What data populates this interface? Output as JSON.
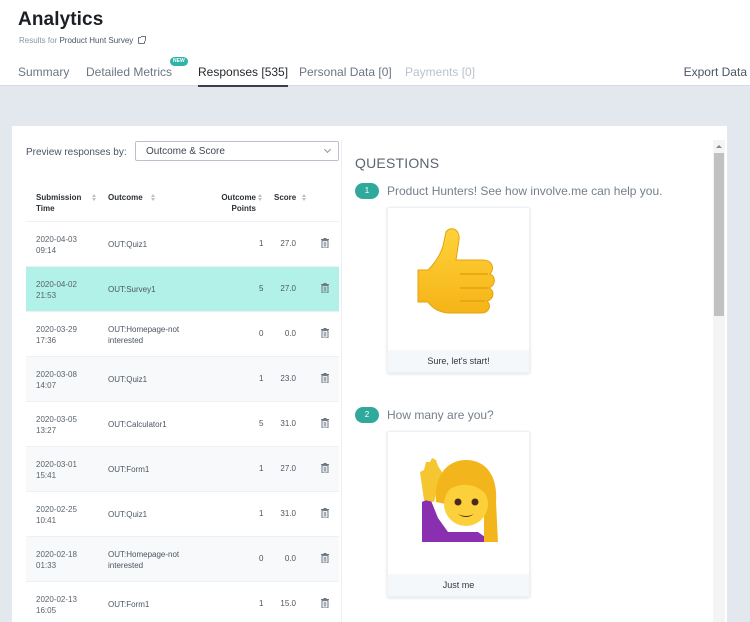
{
  "header": {
    "title": "Analytics",
    "subtitle_prefix": "Results for",
    "survey_name": "Product Hunt Survey",
    "export_label": "Export Data"
  },
  "tabs": [
    {
      "label": "Summary",
      "state": "normal"
    },
    {
      "label": "Detailed Metrics",
      "state": "normal",
      "badge": "NEW"
    },
    {
      "label": "Responses [535]",
      "state": "active"
    },
    {
      "label": "Personal Data [0]",
      "state": "normal"
    },
    {
      "label": "Payments [0]",
      "state": "disabled"
    }
  ],
  "preview": {
    "label": "Preview responses by:",
    "selected": "Outcome & Score"
  },
  "table": {
    "columns": [
      "Submission Time",
      "Outcome",
      "Outcome Points",
      "Score"
    ],
    "rows": [
      {
        "date": "2020-04-03",
        "time": "09:14",
        "outcome": "OUT:Quiz1",
        "points": "1",
        "score": "27.0",
        "selected": false
      },
      {
        "date": "2020-04-02",
        "time": "21:53",
        "outcome": "OUT:Survey1",
        "points": "5",
        "score": "27.0",
        "selected": true
      },
      {
        "date": "2020-03-29",
        "time": "17:36",
        "outcome": "OUT:Homepage-not interested",
        "points": "0",
        "score": "0.0",
        "selected": false
      },
      {
        "date": "2020-03-08",
        "time": "14:07",
        "outcome": "OUT:Quiz1",
        "points": "1",
        "score": "23.0",
        "selected": false
      },
      {
        "date": "2020-03-05",
        "time": "13:27",
        "outcome": "OUT:Calculator1",
        "points": "5",
        "score": "31.0",
        "selected": false
      },
      {
        "date": "2020-03-01",
        "time": "15:41",
        "outcome": "OUT:Form1",
        "points": "1",
        "score": "27.0",
        "selected": false
      },
      {
        "date": "2020-02-25",
        "time": "10:41",
        "outcome": "OUT:Quiz1",
        "points": "1",
        "score": "31.0",
        "selected": false
      },
      {
        "date": "2020-02-18",
        "time": "01:33",
        "outcome": "OUT:Homepage-not interested",
        "points": "0",
        "score": "0.0",
        "selected": false
      },
      {
        "date": "2020-02-13",
        "time": "16:05",
        "outcome": "OUT:Form1",
        "points": "1",
        "score": "15.0",
        "selected": false
      }
    ]
  },
  "questions": {
    "title": "QUESTIONS",
    "items": [
      {
        "number": "1",
        "text": "Product Hunters! See how involve.me can help you.",
        "answer": "Sure, let's start!",
        "image": "thumbs-up-emoji"
      },
      {
        "number": "2",
        "text": "How many are you?",
        "answer": "Just me",
        "image": "woman-raising-hand-emoji"
      }
    ]
  },
  "colors": {
    "accent": "#2fa99b",
    "selected_row": "#b2f1e8",
    "background": "#e3e8ef"
  }
}
